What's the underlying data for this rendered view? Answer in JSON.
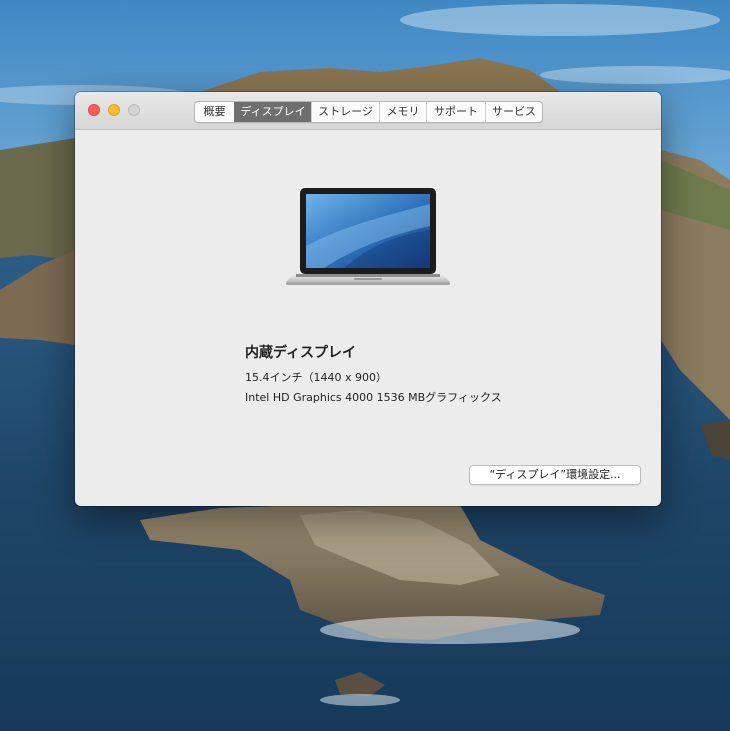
{
  "window": {
    "tabs": [
      {
        "label": "概要"
      },
      {
        "label": "ディスプレイ"
      },
      {
        "label": "ストレージ"
      },
      {
        "label": "メモリ"
      },
      {
        "label": "サポート"
      },
      {
        "label": "サービス"
      }
    ],
    "active_tab": "ディスプレイ"
  },
  "display": {
    "name": "内蔵ディスプレイ",
    "size": "15.4インチ（1440 x 900）",
    "graphics": "Intel HD Graphics 4000 1536 MBグラフィックス"
  },
  "button": {
    "prefs_label": "“ディスプレイ”環境設定..."
  },
  "colors": {
    "close": "#fc5f57",
    "minimize": "#fdbc2e",
    "zoom_disabled": "#d3d3d3",
    "active_tab": "#6e6e6e"
  },
  "icons": {
    "close": "close-icon",
    "minimize": "minimize-icon",
    "zoom": "zoom-icon",
    "laptop": "macbook-pro-icon"
  }
}
